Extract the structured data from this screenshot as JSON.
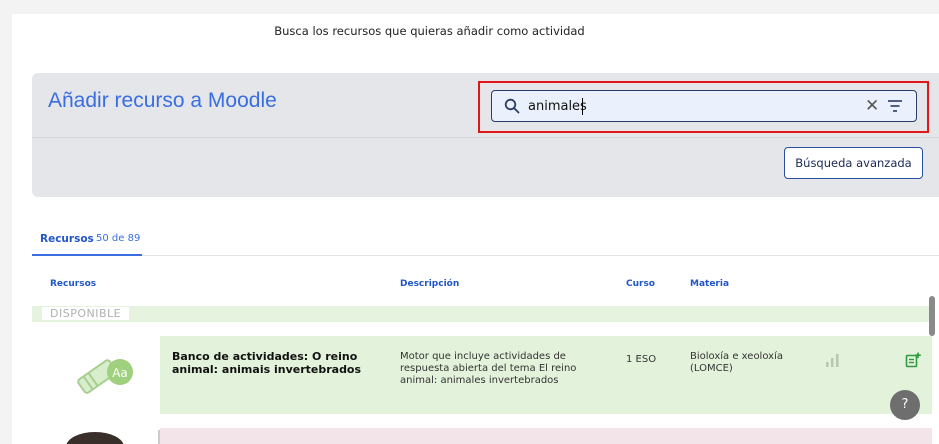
{
  "intro_text": "Busca los recursos que quieras añadir como actividad",
  "header": {
    "title": "Añadir recurso a Moodle",
    "search": {
      "value": "animales",
      "placeholder": ""
    },
    "advanced_button": "Búsqueda avanzada"
  },
  "tabs": [
    {
      "label": "Recursos",
      "count": "50 de 89"
    }
  ],
  "columns": {
    "resources": "Recursos",
    "description": "Descripción",
    "course": "Curso",
    "subject": "Materia"
  },
  "previous_row": {
    "status_label": "DISPONIBLE"
  },
  "rows": [
    {
      "thumb_letters": "Aa",
      "title": "Banco de actividades: O reino animal: animais invertebrados",
      "description": "Motor que incluye actividades de respuesta abierta del tema El reino animal: animales invertebrados",
      "course": "1 ESO",
      "subject": "Bioloxía e xeoloxía (LOMCE)"
    }
  ],
  "help_label": "?",
  "colors": {
    "accent": "#3a6ee0",
    "highlight": "#e0161b",
    "row_available": "#e3f2da",
    "row_other": "#f3e4ea"
  }
}
